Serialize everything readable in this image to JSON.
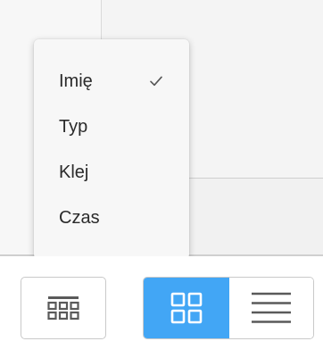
{
  "sort_menu": {
    "items": [
      {
        "label": "Imię",
        "selected": true
      },
      {
        "label": "Typ",
        "selected": false
      },
      {
        "label": "Klej",
        "selected": false
      },
      {
        "label": "Czas",
        "selected": false
      }
    ]
  },
  "toolbar": {
    "table_view_icon": "table-view-icon",
    "grid_view_icon": "grid-view-icon",
    "list_view_icon": "list-view-icon",
    "active_view": "grid"
  },
  "colors": {
    "accent": "#42a6f5",
    "popup_bg": "#f7f7f7",
    "text": "#2a2a2a",
    "icon": "#5a5a5a"
  }
}
